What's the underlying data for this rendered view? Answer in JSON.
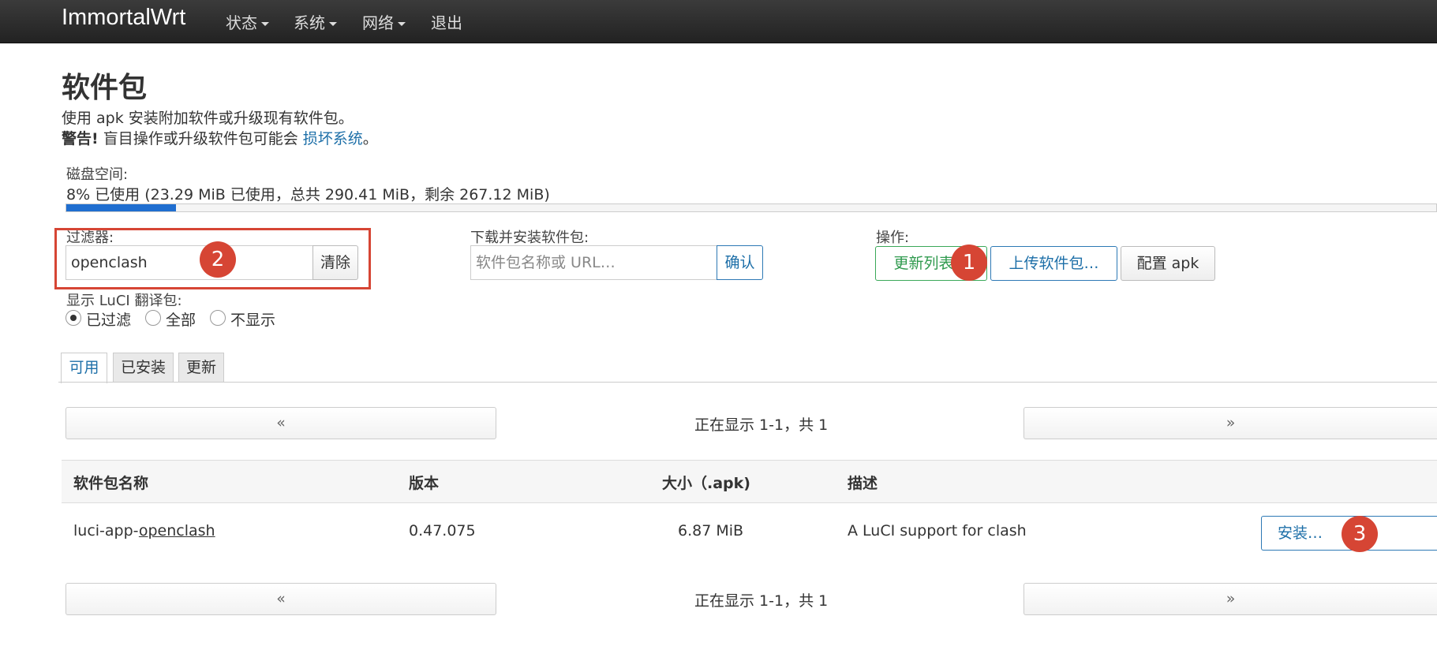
{
  "nav": {
    "brand": "ImmortalWrt",
    "menus": [
      "状态",
      "系统",
      "网络"
    ],
    "logout": "退出"
  },
  "page": {
    "title": "软件包",
    "lead": "使用 apk 安装附加软件或升级现有软件包。",
    "warning_label": "警告!",
    "warning_text": " 盲目操作或升级软件包可能会 ",
    "warning_link": "损坏系统",
    "warning_end": "。"
  },
  "disk": {
    "label": "磁盘空间:",
    "summary": "8% 已使用 (23.29 MiB 已使用，总共 290.41 MiB，剩余 267.12 MiB)",
    "used_fraction": 0.08
  },
  "filter": {
    "label": "过滤器:",
    "value": "openclash",
    "clear_label": "清除"
  },
  "download": {
    "label": "下载并安装软件包:",
    "placeholder": "软件包名称或 URL…",
    "confirm_label": "确认"
  },
  "actions": {
    "label": "操作:",
    "update_lists": "更新列表…",
    "upload": "上传软件包…",
    "configure": "配置 apk"
  },
  "translations": {
    "label": "显示 LuCI 翻译包:",
    "options": [
      "已过滤",
      "全部",
      "不显示"
    ],
    "selected": "已过滤"
  },
  "tabs": [
    "可用",
    "已安装",
    "更新"
  ],
  "pager": {
    "prev": "«",
    "next": "»",
    "info": "正在显示 1-1，共 1"
  },
  "table": {
    "headers": [
      "软件包名称",
      "版本",
      "大小（.apk)",
      "描述"
    ],
    "rows": [
      {
        "name_prefix": "luci-app-",
        "name_link": "openclash",
        "version": "0.47.075",
        "size": "6.87 MiB",
        "description": "A LuCI support for clash",
        "action": "安装…"
      }
    ]
  },
  "annotations": [
    "1",
    "2",
    "3"
  ],
  "colors": {
    "navbar": "#222222",
    "accent_blue": "#1d6fa8",
    "progress": "#1f6ed0",
    "success_green": "#2f9a4e",
    "annotation_red": "#d64534"
  }
}
